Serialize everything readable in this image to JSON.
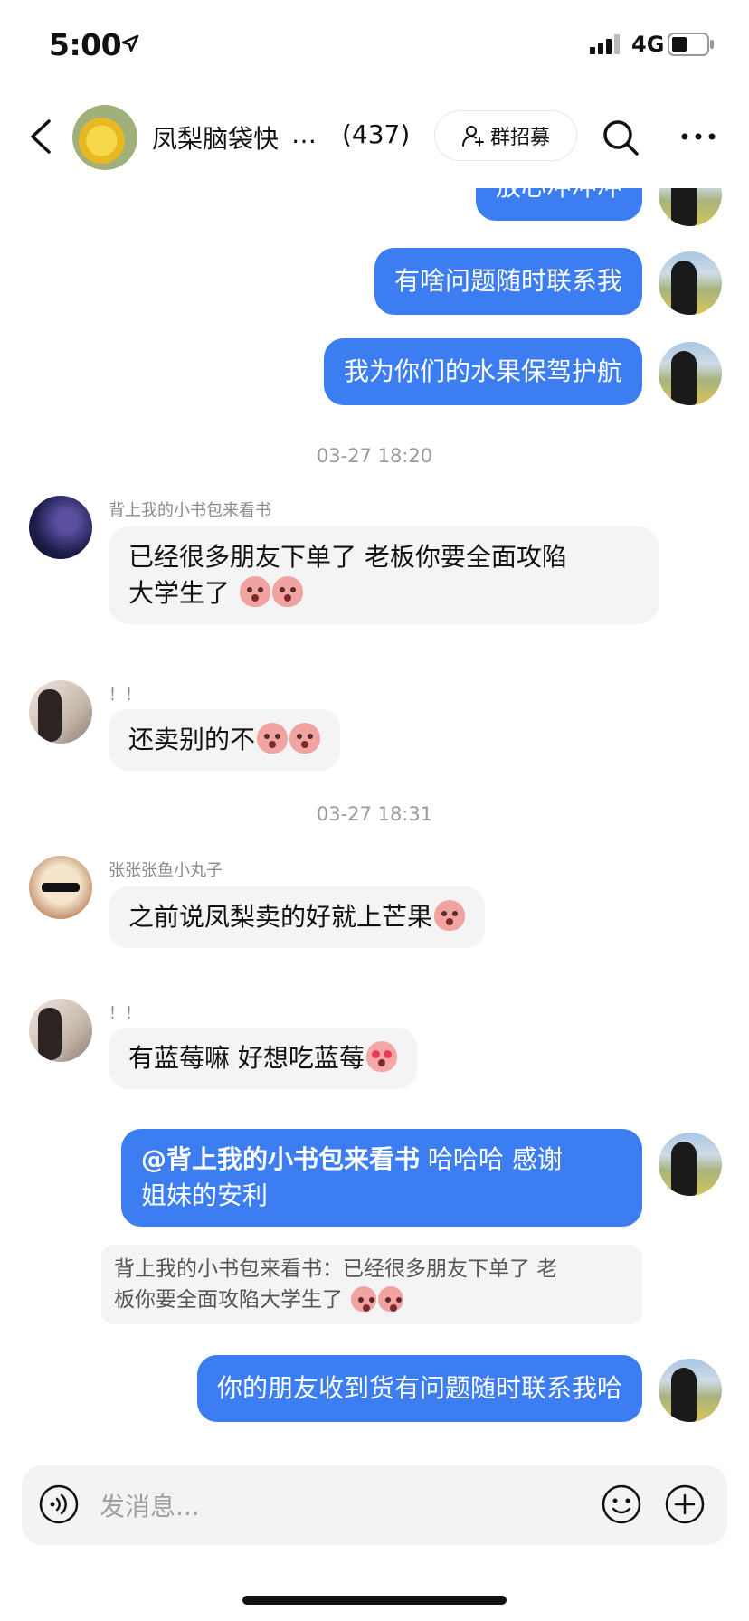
{
  "status_bar": {
    "time": "5:00",
    "network": "4G"
  },
  "header": {
    "group_name": "凤梨脑袋快",
    "ellipsis": "…",
    "member_count": "(437)",
    "recruit_label": "群招募"
  },
  "messages": [
    {
      "type": "out",
      "text": "放心冲冲冲"
    },
    {
      "type": "out",
      "text": "有啥问题随时联系我"
    },
    {
      "type": "out",
      "text": "我为你们的水果保驾护航"
    },
    {
      "type": "time",
      "text": "03-27 18:20"
    },
    {
      "type": "in",
      "sender": "背上我的小书包来看书",
      "line1": "已经很多朋友下单了 老板你要全面攻陷",
      "line2": "大学生了"
    },
    {
      "type": "in",
      "sender": "！！",
      "text": "还卖别的不"
    },
    {
      "type": "time",
      "text": "03-27 18:31"
    },
    {
      "type": "in",
      "sender": "张张张鱼小丸子",
      "text": "之前说凤梨卖的好就上芒果"
    },
    {
      "type": "in",
      "sender": "！！",
      "text": "有蓝莓嘛 好想吃蓝莓"
    },
    {
      "type": "out",
      "mention": "@背上我的小书包来看书",
      "line1_rest": " 哈哈哈 感谢",
      "line2": "姐妹的安利"
    },
    {
      "type": "quote",
      "line1": "背上我的小书包来看书：已经很多朋友下单了 老",
      "line2": "板你要全面攻陷大学生了"
    },
    {
      "type": "out",
      "text": "你的朋友收到货有问题随时联系我哈"
    }
  ],
  "input": {
    "placeholder": "发消息..."
  },
  "colors": {
    "accent": "#3c7df1",
    "incoming_bubble": "#f4f4f4",
    "timestamp": "#9b9b9b"
  },
  "icons": [
    "location-arrow-icon",
    "signal-icon",
    "battery-icon",
    "back-icon",
    "add-user-icon",
    "search-icon",
    "more-icon",
    "voice-icon",
    "emoji-icon",
    "plus-icon"
  ]
}
